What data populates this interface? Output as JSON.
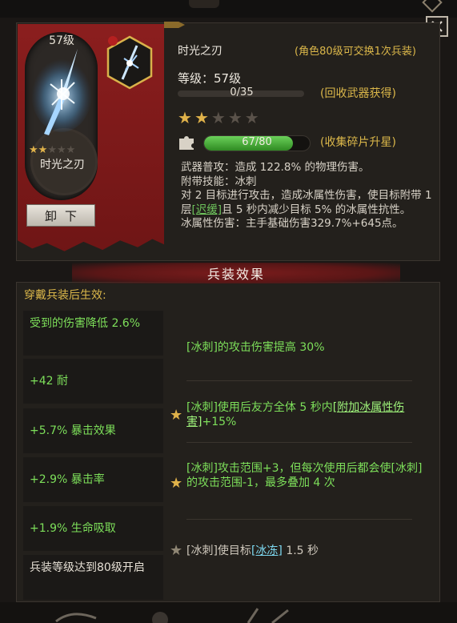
{
  "window": {
    "close_label": "×"
  },
  "weapon": {
    "level_badge": "57级",
    "name": "时光之刃",
    "card_stars_on": 2,
    "card_stars_total": 5,
    "unequip_label": "卸下",
    "exchange_note": "(角色80级可交换1次兵装)",
    "level_text": "等级：57级",
    "exp_text": "0/35",
    "exp_fraction": 0,
    "recycle_note": "(回收武器获得)",
    "rank_stars_on": 2,
    "rank_stars_total": 5,
    "fragment_text": "67/80",
    "fragment_fraction": 0.8375,
    "collect_note": "(收集碎片升星)",
    "desc": {
      "line1": "武器普攻：造成 122.8% 的物理伤害。",
      "line2": "附带技能：冰刺",
      "line3a": "对 2 目标进行攻击，造成冰属性伤害，使目标附带 1 层",
      "line3_link": "[迟缓]",
      "line3b": "且 5 秒内减少目标 5% 的冰属性抗性。",
      "line4": "冰属性伤害：主手基础伤害329.7%+645点。"
    }
  },
  "effects_section": {
    "title": "兵装效果",
    "subhead": "穿戴兵装后生效:",
    "attributes": [
      "受到的伤害降低 2.6%",
      "+42 耐",
      "+5.7% 暴击效果",
      "+2.9% 暴击率",
      "+1.9% 生命吸取",
      "兵装等级达到80级开启"
    ],
    "effects": [
      {
        "text": "[冰刺]的攻击伤害提高 30%"
      },
      {
        "pre": "[冰刺]使用后友方全体 5 秒内",
        "link": "[附加冰属性伤害]",
        "post": "+15%"
      },
      {
        "text": "[冰刺]攻击范围+3，但每次使用后都会使[冰刺]的攻击范围-1，最多叠加 4 次"
      },
      {
        "pre": "[冰刺]使目标",
        "link": "[冰冻]",
        "post": " 1.5 秒"
      }
    ]
  },
  "colors": {
    "banner": "#8b1e1e",
    "gold": "#dbb74a",
    "green": "#7ddf5a"
  },
  "icons": {
    "close": "close-icon",
    "fragment": "puzzle-icon",
    "star": "star-icon",
    "class_badge": "hex-badge-icon"
  }
}
